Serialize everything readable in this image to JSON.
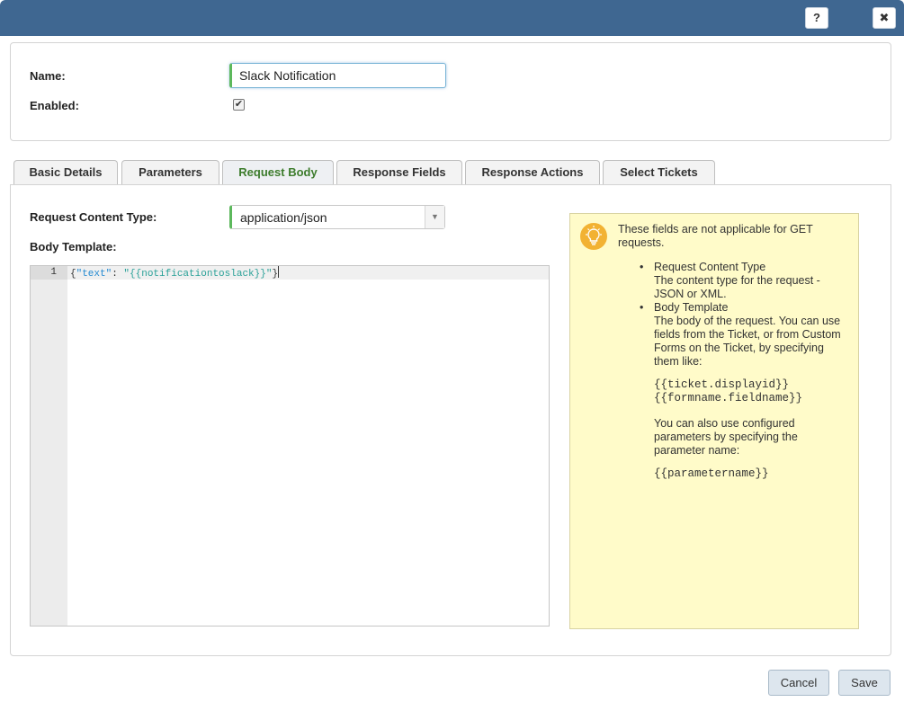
{
  "titlebar": {
    "help_label": "?",
    "close_label": "✖",
    "color": "#3f6791"
  },
  "form": {
    "name_label": "Name:",
    "name_value": "Slack Notification",
    "enabled_label": "Enabled:",
    "enabled_checked": true,
    "check_mark": "✔"
  },
  "tabs": [
    {
      "label": "Basic Details",
      "active": false
    },
    {
      "label": "Parameters",
      "active": false
    },
    {
      "label": "Request Body",
      "active": true
    },
    {
      "label": "Response Fields",
      "active": false
    },
    {
      "label": "Response Actions",
      "active": false
    },
    {
      "label": "Select Tickets",
      "active": false
    }
  ],
  "request_body": {
    "content_type_label": "Request Content Type:",
    "content_type_value": "application/json",
    "select_arrow": "▼",
    "body_template_label": "Body Template:",
    "editor": {
      "line_number": "1",
      "open_brace": "{",
      "key": "\"text\"",
      "colon": ": ",
      "string": "\"{{notificationtoslack}}\"",
      "close_brace": "}"
    }
  },
  "help": {
    "icon": "lightbulb-icon",
    "intro": "These fields are not applicable for GET requests.",
    "items": [
      {
        "title": "Request Content Type",
        "text": "The content type for the request - JSON or XML."
      },
      {
        "title": "Body Template",
        "text": "The body of the request. You can use fields from the Ticket, or from Custom Forms on the Ticket, by specifying them like:"
      }
    ],
    "example_1": "{{ticket.displayid}}",
    "example_2": "{{formname.fieldname}}",
    "param_text": "You can also use configured parameters by specifying the parameter name:",
    "example_3": "{{parametername}}"
  },
  "footer": {
    "cancel_label": "Cancel",
    "save_label": "Save"
  }
}
